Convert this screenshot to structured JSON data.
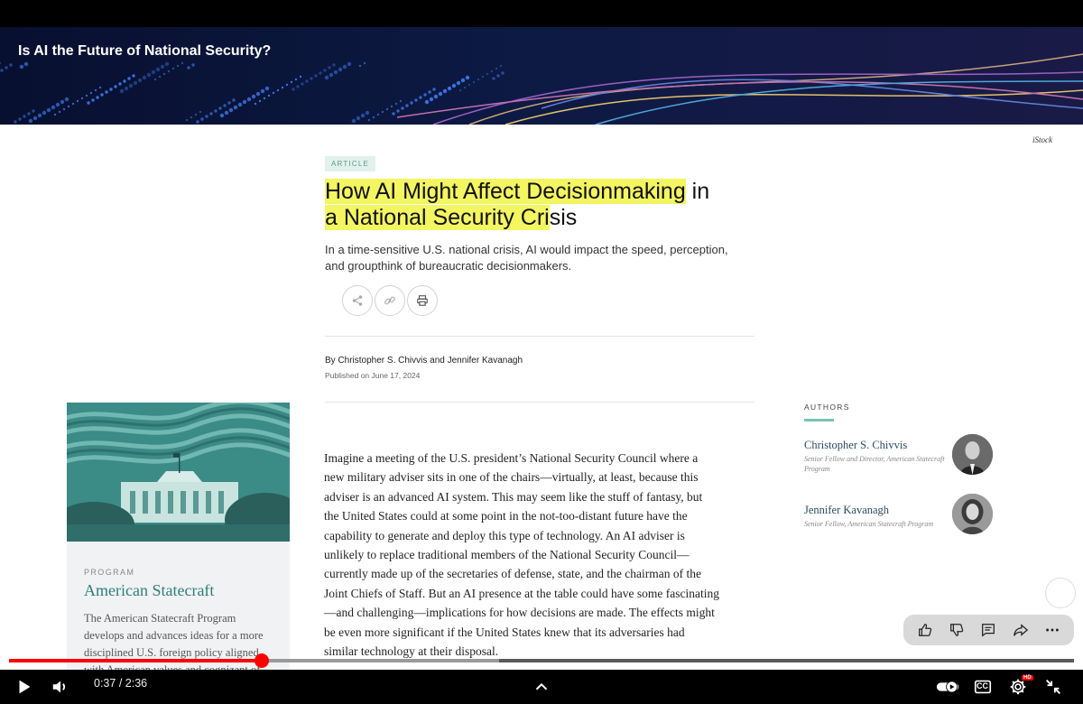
{
  "video": {
    "title": "Is AI the Future of National Security?"
  },
  "article": {
    "image_credit": "iStock",
    "tag": "ARTICLE",
    "headline_highlighted_1": "How AI Might Affect Decisionmaking",
    "headline_rest_1": " in",
    "headline_highlighted_2": "a National Security Cri",
    "headline_rest_2": "sis",
    "subhead": "In a time-sensitive U.S. national crisis, AI would impact the speed, perception, and groupthink of bureaucratic decisionmakers.",
    "share_icons": [
      "share-icon",
      "link-icon",
      "print-icon"
    ],
    "byline": "By Christopher S. Chivvis and Jennifer Kavanagh",
    "published": "Published on June 17, 2024",
    "body_lines": [
      "Imagine a meeting of the U.S. president’s National Security Council where a",
      "new military adviser sits in one of the chairs—virtually, at least, because this",
      "adviser is an advanced AI system. This may seem like the stuff of fantasy, but",
      "the United States could at some point in the not-too-distant future have the",
      "capability to generate and deploy this type of technology. An AI adviser is",
      "unlikely to replace traditional members of the National Security Council—",
      "currently made up of the secretaries of defense, state, and the chairman of the",
      "Joint Chiefs of Staff. But an AI presence at the table could have some fascinating",
      "—and challenging—implications for how decisions are made. The effects might",
      "be even more significant if the United States knew that its adversaries had",
      "similar technology at their disposal."
    ]
  },
  "program": {
    "label": "PROGRAM",
    "title": "American Statecraft",
    "description_lines": [
      "The American Statecraft Program",
      "develops and advances ideas for a more",
      "disciplined U.S. foreign policy aligned",
      "with American values and cognizant of"
    ]
  },
  "authors": {
    "heading": "AUTHORS",
    "list": [
      {
        "name": "Christopher S. Chivvis",
        "role": "Senior Fellow and Director, American Statecraft Program"
      },
      {
        "name": "Jennifer Kavanagh",
        "role": "Senior Fellow, American Statecraft Program"
      }
    ]
  },
  "engagement": {
    "icons": [
      "thumbs-up-icon",
      "thumbs-down-icon",
      "comment-icon",
      "share-icon",
      "more-icon"
    ]
  },
  "player": {
    "time_current": "0:37",
    "time_separator": " / ",
    "time_total": "2:36",
    "progress_fraction": 0.237,
    "buffer_fraction": 0.46,
    "hd_badge": "HD",
    "cc_label": "CC",
    "accent_color": "#ff0000"
  }
}
